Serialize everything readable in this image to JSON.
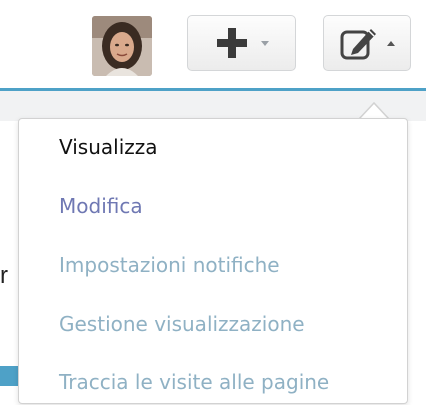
{
  "colors": {
    "accent": "#4ea1c7",
    "active_text": "#111111",
    "link_text": "#6f78b3",
    "muted_text": "#8fb1c4"
  },
  "toolbar": {
    "avatar_icon": "user-avatar",
    "add_icon": "plus-icon",
    "edit_icon": "pencil-edit-icon"
  },
  "background": {
    "partial_letter": "r"
  },
  "menu": {
    "items": [
      {
        "label": "Visualizza",
        "state": "active"
      },
      {
        "label": "Modifica",
        "state": "link"
      },
      {
        "label": "Impostazioni notifiche",
        "state": "muted"
      },
      {
        "label": "Gestione visualizzazione",
        "state": "muted"
      },
      {
        "label": "Traccia le visite alle pagine",
        "state": "muted"
      }
    ]
  }
}
